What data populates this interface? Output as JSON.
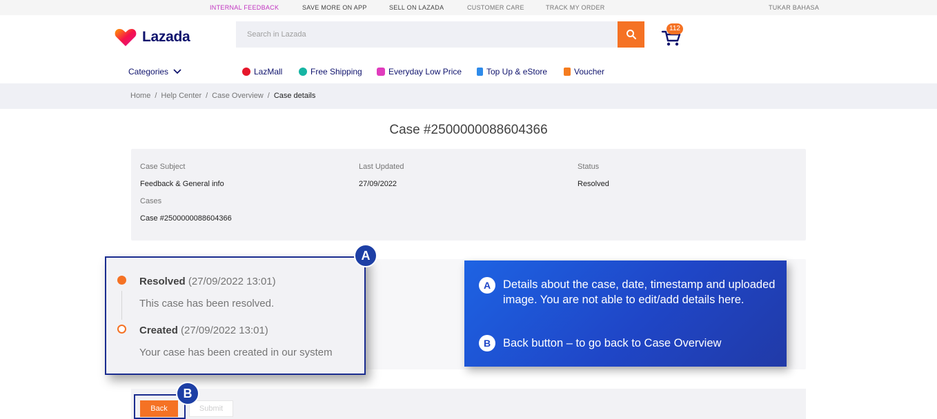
{
  "topbar": {
    "links": [
      "INTERNAL FEEDBACK",
      "SAVE MORE ON APP",
      "SELL ON LAZADA",
      "CUSTOMER CARE",
      "TRACK MY ORDER",
      "TUKAR BAHASA"
    ]
  },
  "header": {
    "logo_text": "Lazada",
    "search_placeholder": "Search in Lazada",
    "cart_count": "112"
  },
  "nav": {
    "categories": "Categories",
    "items": [
      "LazMall",
      "Free Shipping",
      "Everyday Low Price",
      "Top Up & eStore",
      "Voucher"
    ]
  },
  "breadcrumb": [
    "Home",
    "Help Center",
    "Case Overview",
    "Case details"
  ],
  "page": {
    "title": "Case #2500000088604366"
  },
  "summary": {
    "subject_label": "Case Subject",
    "subject_value": "Feedback & General info",
    "updated_label": "Last Updated",
    "updated_value": "27/09/2022",
    "status_label": "Status",
    "status_value": "Resolved",
    "cases_label": "Cases",
    "cases_value": "Case #2500000088604366"
  },
  "timeline": [
    {
      "status": "Resolved",
      "time": "(27/09/2022 13:01)",
      "desc": "This case has been resolved."
    },
    {
      "status": "Created",
      "time": "(27/09/2022 13:01)",
      "desc": "Your case has been created in our system"
    }
  ],
  "annotations": {
    "a_marker": "A",
    "b_marker": "B",
    "a_text": "Details about the case, date, timestamp and uploaded image. You are not able to edit/add details here.",
    "b_text": "Back button – to go back to Case Overview"
  },
  "buttons": {
    "back": "Back",
    "submit": "Submit"
  },
  "colors": {
    "brand_orange": "#f57224",
    "navy": "#0f136d",
    "annotation_blue": "#1f46c7"
  }
}
